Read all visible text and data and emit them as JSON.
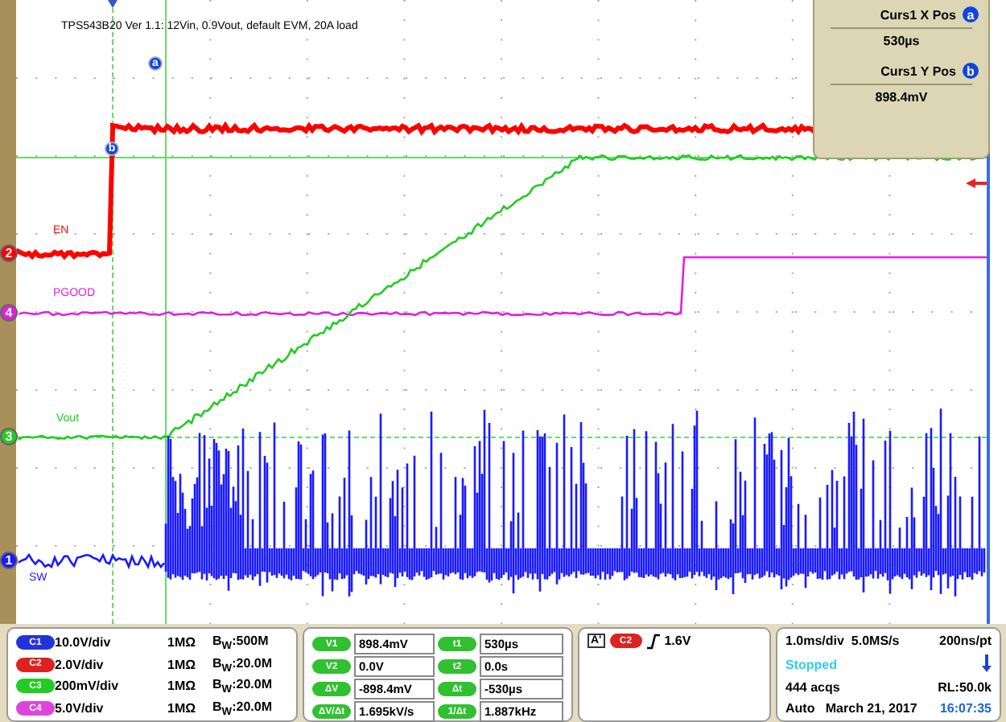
{
  "title_note": "TPS543B20 Ver 1.1: 12Vin, 0.9Vout,  default EVM, 20A load",
  "channels": [
    {
      "number": "2",
      "label": "EN",
      "color": "#ff0000"
    },
    {
      "number": "4",
      "label": "PGOOD",
      "color": "#e020e0"
    },
    {
      "number": "3",
      "label": "Vout",
      "color": "#22cc22"
    },
    {
      "number": "1",
      "label": "SW",
      "color": "#1a1aff"
    }
  ],
  "cursor_markers": [
    {
      "label": "a"
    },
    {
      "label": "b"
    }
  ],
  "cursor_readout": [
    {
      "title": "Curs1 X Pos",
      "badge": "a",
      "value": "530µs"
    },
    {
      "title": "Curs1 Y Pos",
      "badge": "b",
      "value": "898.4mV"
    }
  ],
  "channel_settings": [
    {
      "badge": "C1",
      "color": "#2233dd",
      "scale": "10.0V/div",
      "impedance": "1MΩ",
      "bandwidth": "B$_{W}$:500M"
    },
    {
      "badge": "C2",
      "color": "#dd2222",
      "scale": "2.0V/div",
      "impedance": "1MΩ",
      "bandwidth": "B$_{W}$:20.0M"
    },
    {
      "badge": "C3",
      "color": "#22cc22",
      "scale": "200mV/div",
      "impedance": "1MΩ",
      "bandwidth": "B$_{W}$:20.0M"
    },
    {
      "badge": "C4",
      "color": "#dd44dd",
      "scale": "5.0V/div",
      "impedance": "1MΩ",
      "bandwidth": "B$_{W}$:20.0M"
    }
  ],
  "voltage_readouts": [
    {
      "badge": "V1",
      "value": "898.4mV"
    },
    {
      "badge": "V2",
      "value": "0.0V"
    },
    {
      "badge": "ΔV",
      "value": "-898.4mV"
    },
    {
      "badge": "ΔV/Δt",
      "value": "1.695kV/s"
    }
  ],
  "time_readouts": [
    {
      "badge": "t1",
      "value": "530µs"
    },
    {
      "badge": "t2",
      "value": "0.0s"
    },
    {
      "badge": "Δt",
      "value": "-530µs"
    },
    {
      "badge": "1/Δt",
      "value": "1.887kHz"
    }
  ],
  "trigger": {
    "source_badge": "A'",
    "channel_badge": "C2",
    "level": "1.6V"
  },
  "acquisition": {
    "timebase": "1.0ms/div",
    "sample_rate": "5.0MS/s",
    "resolution": "200ns/pt",
    "state": "Stopped",
    "acquisitions": "444 acqs",
    "record_length": "RL:50.0k",
    "mode": "Auto",
    "date": "March 21, 2017",
    "time": "16:07:35"
  }
}
